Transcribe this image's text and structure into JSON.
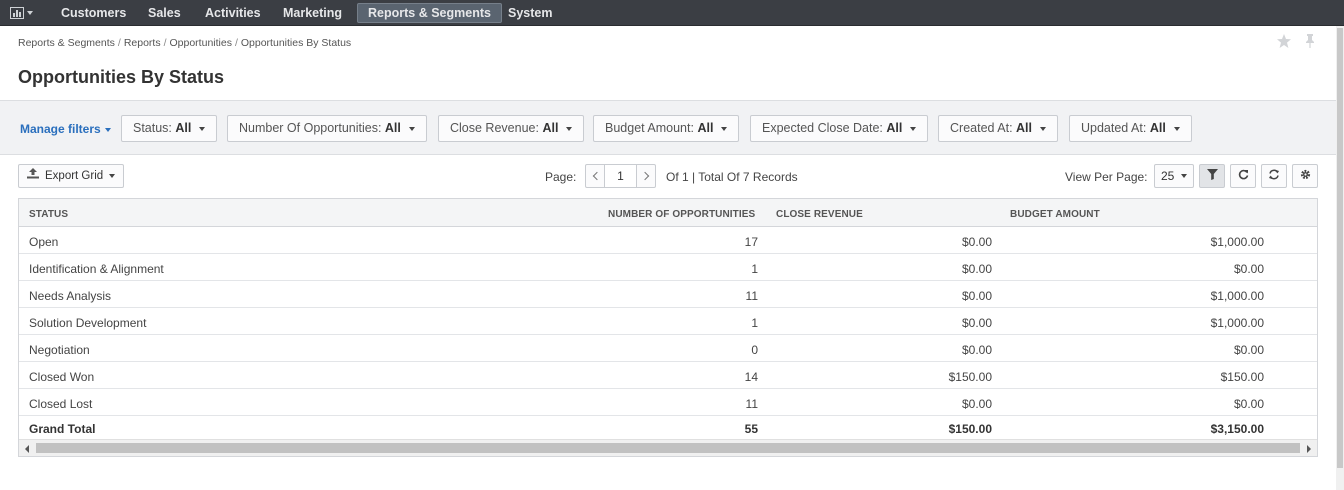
{
  "nav": {
    "logo_icon": "bar-chart-icon",
    "items": [
      "Customers",
      "Sales",
      "Activities",
      "Marketing",
      "Reports & Segments",
      "System"
    ],
    "active": "Reports & Segments",
    "colors": {
      "bar": "#3b3e44",
      "active_bg": "#5a6470"
    }
  },
  "breadcrumb": [
    "Reports & Segments",
    "Reports",
    "Opportunities",
    "Opportunities By Status"
  ],
  "header_icons": [
    "star-icon",
    "pin-icon"
  ],
  "page_title": "Opportunities By Status",
  "filters": {
    "manage_label": "Manage filters",
    "items": [
      {
        "label": "Status:",
        "value": "All"
      },
      {
        "label": "Number Of Opportunities:",
        "value": "All"
      },
      {
        "label": "Close Revenue:",
        "value": "All"
      },
      {
        "label": "Budget Amount:",
        "value": "All"
      },
      {
        "label": "Expected Close Date:",
        "value": "All"
      },
      {
        "label": "Created At:",
        "value": "All"
      },
      {
        "label": "Updated At:",
        "value": "All"
      }
    ]
  },
  "toolbar": {
    "export_label": "Export Grid",
    "page_label": "Page:",
    "page_value": "1",
    "page_info": "Of 1 | Total Of 7 Records",
    "view_per_page_label": "View Per Page:",
    "view_per_page_value": "25",
    "tool_icons": [
      "filter-icon",
      "refresh-icon",
      "reset-icon",
      "settings-icon"
    ]
  },
  "grid": {
    "columns": [
      "STATUS",
      "NUMBER OF OPPORTUNITIES",
      "CLOSE REVENUE",
      "BUDGET AMOUNT"
    ],
    "rows": [
      {
        "status": "Open",
        "number": "17",
        "revenue": "$0.00",
        "budget": "$1,000.00"
      },
      {
        "status": "Identification & Alignment",
        "number": "1",
        "revenue": "$0.00",
        "budget": "$0.00"
      },
      {
        "status": "Needs Analysis",
        "number": "11",
        "revenue": "$0.00",
        "budget": "$1,000.00"
      },
      {
        "status": "Solution Development",
        "number": "1",
        "revenue": "$0.00",
        "budget": "$1,000.00"
      },
      {
        "status": "Negotiation",
        "number": "0",
        "revenue": "$0.00",
        "budget": "$0.00"
      },
      {
        "status": "Closed Won",
        "number": "14",
        "revenue": "$150.00",
        "budget": "$150.00"
      },
      {
        "status": "Closed Lost",
        "number": "11",
        "revenue": "$0.00",
        "budget": "$0.00"
      }
    ],
    "total": {
      "status": "Grand Total",
      "number": "55",
      "revenue": "$150.00",
      "budget": "$3,150.00"
    }
  }
}
